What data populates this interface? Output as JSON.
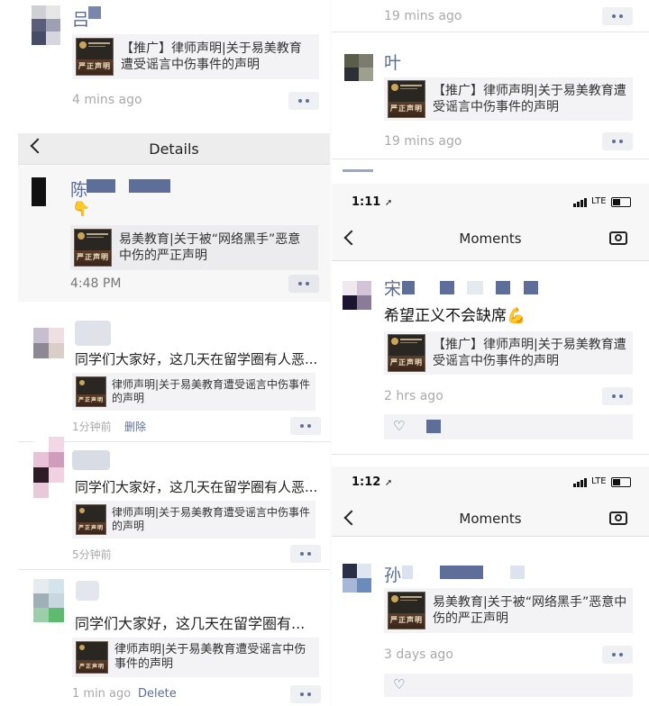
{
  "left_top": {
    "name": "吕",
    "card": "【推广】律师声明|关于易美教育遭受谣言中伤事件的声明",
    "time": "4 mins ago"
  },
  "details": {
    "back_icon": "chevron-left-icon",
    "title": "Details",
    "post": {
      "name": "陈",
      "emoji": "👇",
      "card": "易美教育|关于被“网络黑手”恶意中伤的严正声明",
      "time": "4:48 PM"
    }
  },
  "comments": [
    {
      "text": "同学们大家好，这几天在留学圈有人恶...",
      "card": "律师声明|关于易美教育遭受谣言中伤事件的声明",
      "time": "1分钟前",
      "delete": "删除"
    },
    {
      "text": "同学们大家好，这几天在留学圈有人恶...",
      "card": "律师声明|关于易美教育遭受谣言中伤事件的声明",
      "time": "5分钟前",
      "delete": ""
    },
    {
      "text": "同学们大家好，这几天在留学圈有...",
      "card": "律师声明|关于易美教育遭受谣言中伤事件的声明",
      "time": "1 min ago",
      "delete": "Delete"
    }
  ],
  "right_top": {
    "time1": "19 mins ago",
    "name": "叶",
    "card": "【推广】律师声明|关于易美教育遭受谣言中伤事件的声明",
    "time2": "19 mins ago"
  },
  "moments1": {
    "status_time": "1:11",
    "network": "LTE",
    "title": "Moments",
    "name": "宋",
    "text": "希望正义不会缺席💪",
    "card": "【推广】律师声明|关于易美教育遭受谣言中伤事件的声明",
    "time": "2 hrs ago"
  },
  "moments2": {
    "status_time": "1:12",
    "network": "LTE",
    "title": "Moments",
    "name": "孙",
    "card": "易美教育|关于被“网络黑手”恶意中伤的严正声明",
    "time": "3 days ago"
  },
  "thumb_text": "严正声明",
  "colors": {
    "link": "#5d6e98",
    "time": "#a9a9a9",
    "card_bg": "#f3f3f5"
  }
}
